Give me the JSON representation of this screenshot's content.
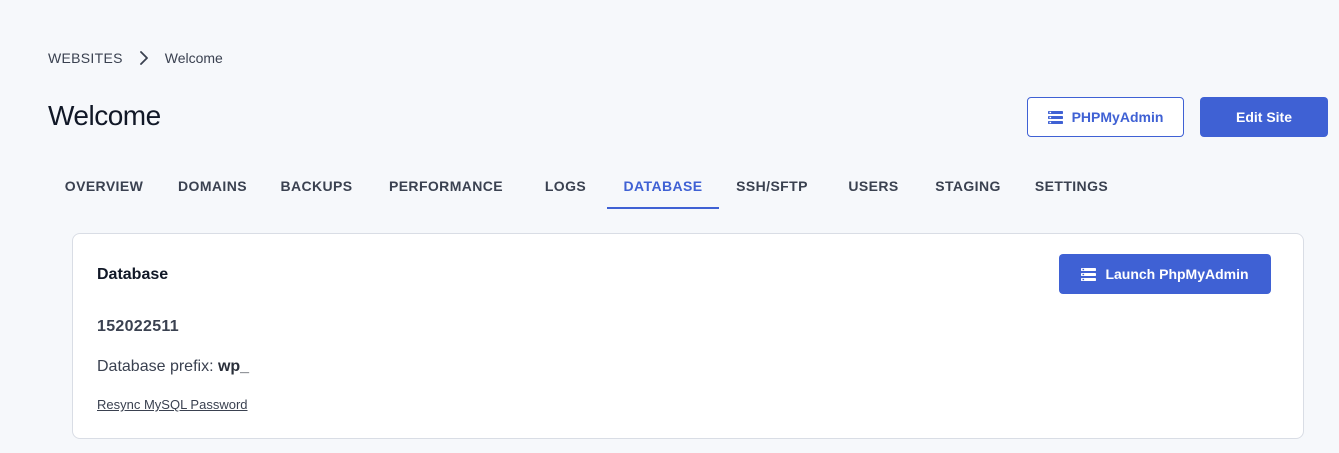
{
  "breadcrumb": {
    "root": "WEBSITES",
    "current": "Welcome"
  },
  "page": {
    "title": "Welcome"
  },
  "header_actions": {
    "phpmyadmin_label": "PHPMyAdmin",
    "edit_site_label": "Edit Site"
  },
  "tabs": [
    {
      "label": "OVERVIEW"
    },
    {
      "label": "DOMAINS"
    },
    {
      "label": "BACKUPS"
    },
    {
      "label": "PERFORMANCE"
    },
    {
      "label": "LOGS"
    },
    {
      "label": "DATABASE",
      "active": true
    },
    {
      "label": "SSH/SFTP"
    },
    {
      "label": "USERS"
    },
    {
      "label": "STAGING"
    },
    {
      "label": "SETTINGS"
    }
  ],
  "database_card": {
    "title": "Database",
    "launch_label": "Launch PhpMyAdmin",
    "db_name": "152022511",
    "prefix_label": "Database prefix:",
    "prefix_value": "wp_",
    "resync_label": "Resync MySQL Password"
  },
  "icons": {
    "breadcrumb_separator": "chevron-right-icon",
    "database": "database-icon"
  },
  "colors": {
    "accent": "#3f61d4",
    "background": "#f6f8fb",
    "card_border": "#d9dde5"
  }
}
